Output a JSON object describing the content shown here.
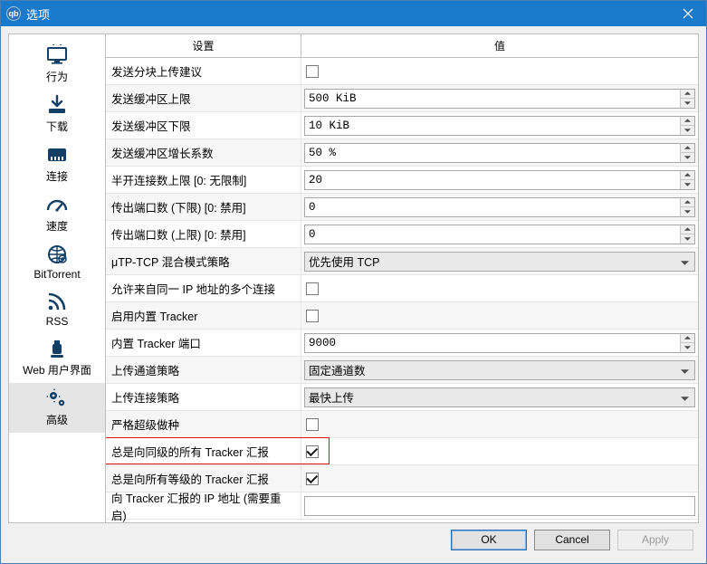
{
  "window": {
    "title": "选项",
    "app_glyph": "qb"
  },
  "sidebar": {
    "items": [
      {
        "label": "行为",
        "icon": "monitor"
      },
      {
        "label": "下载",
        "icon": "download"
      },
      {
        "label": "连接",
        "icon": "ethernet"
      },
      {
        "label": "速度",
        "icon": "gauge"
      },
      {
        "label": "BitTorrent",
        "icon": "globe"
      },
      {
        "label": "RSS",
        "icon": "rss"
      },
      {
        "label": "Web 用户界面",
        "icon": "dongle"
      },
      {
        "label": "高级",
        "icon": "gears"
      }
    ],
    "active_index": 7
  },
  "table": {
    "header_setting": "设置",
    "header_value": "值"
  },
  "rows": [
    {
      "label": "发送分块上传建议",
      "type": "checkbox",
      "checked": false
    },
    {
      "label": "发送缓冲区上限",
      "type": "spin",
      "value": "500 KiB"
    },
    {
      "label": "发送缓冲区下限",
      "type": "spin",
      "value": "10 KiB"
    },
    {
      "label": "发送缓冲区增长系数",
      "type": "spin",
      "value": "50 %"
    },
    {
      "label": "半开连接数上限 [0: 无限制]",
      "type": "spin",
      "value": "20"
    },
    {
      "label": "传出端口数 (下限) [0: 禁用]",
      "type": "spin",
      "value": "0"
    },
    {
      "label": "传出端口数 (上限) [0: 禁用]",
      "type": "spin",
      "value": "0"
    },
    {
      "label": "μTP-TCP 混合模式策略",
      "type": "select",
      "value": "优先使用 TCP"
    },
    {
      "label": "允许来自同一 IP 地址的多个连接",
      "type": "checkbox",
      "checked": false
    },
    {
      "label": "启用内置 Tracker",
      "type": "checkbox",
      "checked": false
    },
    {
      "label": "内置 Tracker 端口",
      "type": "spin",
      "value": "9000"
    },
    {
      "label": "上传通道策略",
      "type": "select",
      "value": "固定通道数"
    },
    {
      "label": "上传连接策略",
      "type": "select",
      "value": "最快上传"
    },
    {
      "label": "严格超级做种",
      "type": "checkbox",
      "checked": false
    },
    {
      "label": "总是向同级的所有 Tracker 汇报",
      "type": "checkbox",
      "checked": true,
      "highlight": true
    },
    {
      "label": "总是向所有等级的 Tracker 汇报",
      "type": "checkbox",
      "checked": true
    },
    {
      "label": "向 Tracker 汇报的 IP 地址 (需要重启)",
      "type": "text",
      "value": ""
    }
  ],
  "buttons": {
    "ok": "OK",
    "cancel": "Cancel",
    "apply": "Apply"
  }
}
